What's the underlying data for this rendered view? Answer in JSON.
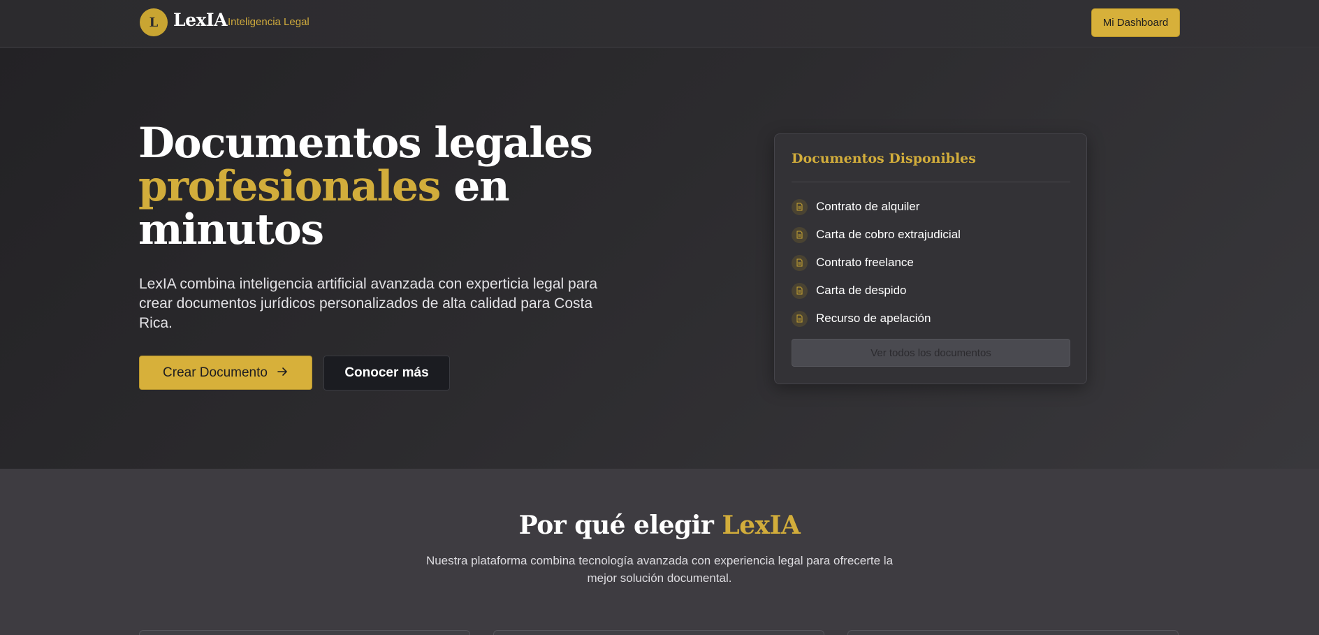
{
  "header": {
    "logo_letter": "L",
    "brand": "LexIA",
    "tagline": "Inteligencia Legal",
    "dashboard_button": "Mi Dashboard"
  },
  "hero": {
    "title_line1": "Documentos legales",
    "title_highlight": "profesionales",
    "title_after": " en",
    "title_line3": "minutos",
    "description": "LexIA combina inteligencia artificial avanzada con experticia legal para crear documentos jurídicos personalizados de alta calidad para Costa Rica.",
    "primary_button": "Crear Documento",
    "secondary_button": "Conocer más"
  },
  "documents_card": {
    "title": "Documentos Disponibles",
    "items": [
      {
        "label": "Contrato de alquiler"
      },
      {
        "label": "Carta de cobro extrajudicial"
      },
      {
        "label": "Contrato freelance"
      },
      {
        "label": "Carta de despido"
      },
      {
        "label": "Recurso de apelación"
      }
    ],
    "view_all": "Ver todos los documentos"
  },
  "features": {
    "title_prefix": "Por qué elegir ",
    "title_highlight": "LexIA",
    "description": "Nuestra plataforma combina tecnología avanzada con experiencia legal para ofrecerte la mejor solución documental."
  },
  "colors": {
    "accent": "#d7b03a",
    "background": "#2a292c",
    "section_background": "#3e3c41"
  }
}
